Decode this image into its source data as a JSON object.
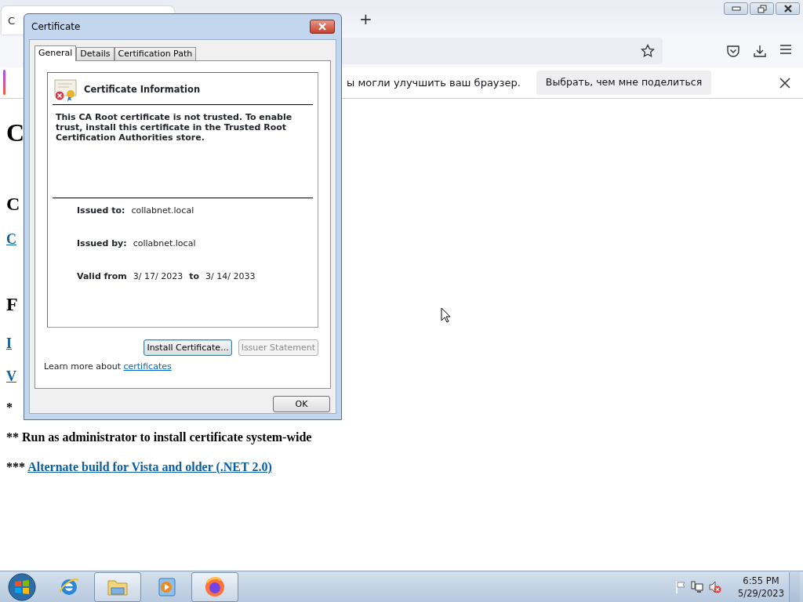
{
  "browser": {
    "tab": {
      "title": "C"
    },
    "new_tab": "+",
    "notification": {
      "message": "ы могли улучшить ваш браузер.",
      "button": "Выбрать, чем мне поделиться"
    }
  },
  "page": {
    "lines": [
      {
        "kind": "heading1",
        "text": "C"
      },
      {
        "kind": "heading2",
        "text": "C"
      },
      {
        "kind": "link",
        "text": "C"
      },
      {
        "kind": "heading2",
        "text": "F"
      },
      {
        "kind": "link",
        "text": "I"
      },
      {
        "kind": "link",
        "text": "V"
      },
      {
        "kind": "text",
        "text": "*"
      },
      {
        "kind": "text",
        "text": "** Run as administrator to install certificate system-wide"
      },
      {
        "kind": "text",
        "text": "***",
        "link": "Alternate build for Vista and older (.NET 2.0)"
      }
    ]
  },
  "dialog": {
    "title": "Certificate",
    "tabs": [
      {
        "label": "General",
        "selected": true
      },
      {
        "label": "Details",
        "selected": false
      },
      {
        "label": "Certification Path",
        "selected": false
      }
    ],
    "heading": "Certificate Information",
    "message": "This CA Root certificate is not trusted. To enable trust, install this certificate in the Trusted Root Certification Authorities store.",
    "fields": [
      {
        "label": "Issued to:",
        "value": "collabnet.local"
      },
      {
        "label": "Issued by:",
        "value": "collabnet.local"
      }
    ],
    "validity": {
      "label": "Valid from",
      "from": "3/ 17/ 2023",
      "to_label": "to",
      "to": "3/ 14/ 2033"
    },
    "buttons": [
      {
        "label": "Install Certificate...",
        "focused": true,
        "disabled": false
      },
      {
        "label": "Issuer Statement",
        "focused": false,
        "disabled": true
      }
    ],
    "learn_more": {
      "text": "Learn more about",
      "link": "certificates"
    },
    "ok": "OK"
  },
  "taskbar": {
    "items": [
      {
        "kind": "ie",
        "running": false
      },
      {
        "kind": "explorer",
        "running": true
      },
      {
        "kind": "media",
        "running": false
      },
      {
        "kind": "firefox",
        "running": true
      }
    ],
    "time": "6:55 PM",
    "date": "5/29/2023"
  }
}
